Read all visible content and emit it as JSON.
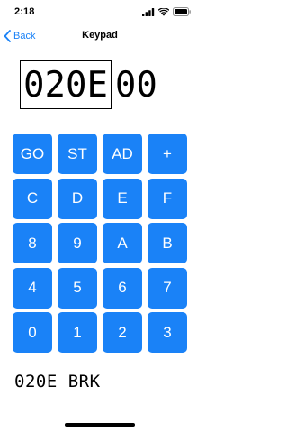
{
  "status_bar": {
    "time": "2:18",
    "icons": [
      "cellular-signal-icon",
      "wifi-icon",
      "battery-icon"
    ]
  },
  "nav": {
    "back_label": "Back",
    "title": "Keypad"
  },
  "display": {
    "address": "020E",
    "data": "00"
  },
  "keypad": {
    "rows": [
      [
        "GO",
        "ST",
        "AD",
        "+"
      ],
      [
        "C",
        "D",
        "E",
        "F"
      ],
      [
        "8",
        "9",
        "A",
        "B"
      ],
      [
        "4",
        "5",
        "6",
        "7"
      ],
      [
        "0",
        "1",
        "2",
        "3"
      ]
    ]
  },
  "status_line": "020E BRK",
  "colors": {
    "accent": "#1a82f7",
    "key_text": "#ffffff",
    "background": "#ffffff"
  }
}
